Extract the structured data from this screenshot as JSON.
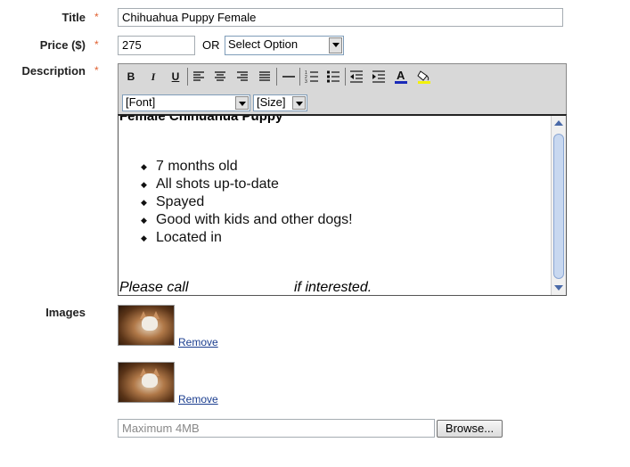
{
  "form": {
    "title_label": "Title",
    "title_value": "Chihuahua Puppy Female",
    "price_label": "Price ($)",
    "price_value": "275",
    "or_label": "OR",
    "price_select": "Select Option",
    "description_label": "Description",
    "required_mark": "*",
    "images_label": "Images"
  },
  "toolbar": {
    "bold": "B",
    "italic": "I",
    "underline": "U",
    "font_select": "[Font]",
    "size_select": "[Size]"
  },
  "editor": {
    "heading": "Female Chihuahua Puppy",
    "bullets": [
      "7 months old",
      "All shots up-to-date",
      "Spayed",
      "Good with kids and other dogs!",
      "Located in"
    ],
    "footer_left": "Please call",
    "footer_right": "if interested."
  },
  "images": {
    "remove_label": "Remove",
    "file_placeholder": "Maximum 4MB",
    "browse_label": "Browse..."
  }
}
